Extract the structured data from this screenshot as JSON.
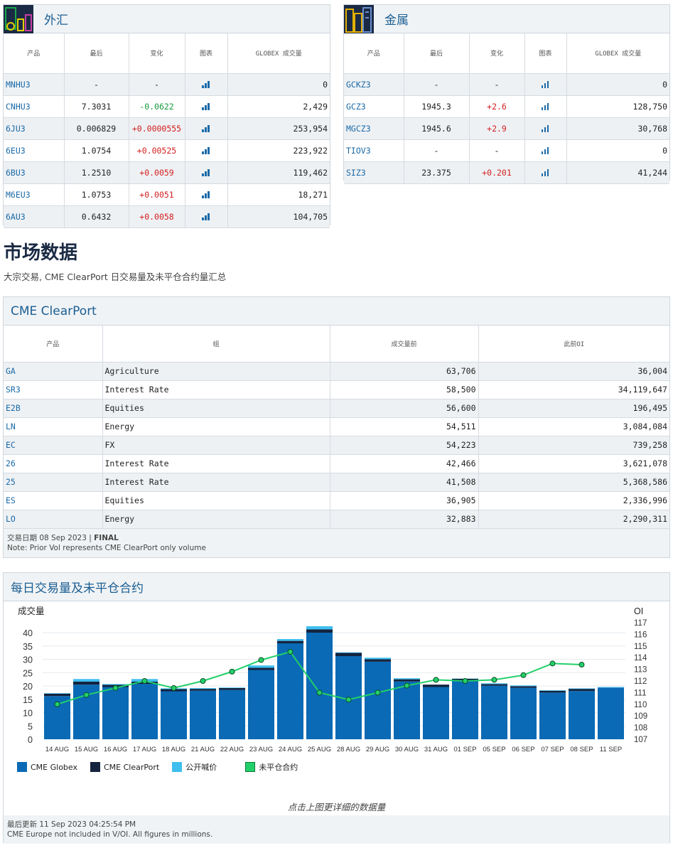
{
  "fx": {
    "title": "外汇",
    "headers": [
      "产品",
      "最后",
      "变化",
      "图表",
      "GLOBEX 成交量"
    ],
    "rows": [
      {
        "sym": "MNHU3",
        "last": "-",
        "chg": "-",
        "dir": "none",
        "vol": "0"
      },
      {
        "sym": "CNHU3",
        "last": "7.3031",
        "chg": "-0.0622",
        "dir": "neg",
        "vol": "2,429"
      },
      {
        "sym": "6JU3",
        "last": "0.006829",
        "chg": "+0.0000555",
        "dir": "pos",
        "vol": "253,954"
      },
      {
        "sym": "6EU3",
        "last": "1.0754",
        "chg": "+0.00525",
        "dir": "pos",
        "vol": "223,922"
      },
      {
        "sym": "6BU3",
        "last": "1.2510",
        "chg": "+0.0059",
        "dir": "pos",
        "vol": "119,462"
      },
      {
        "sym": "M6EU3",
        "last": "1.0753",
        "chg": "+0.0051",
        "dir": "pos",
        "vol": "18,271"
      },
      {
        "sym": "6AU3",
        "last": "0.6432",
        "chg": "+0.0058",
        "dir": "pos",
        "vol": "104,705"
      }
    ]
  },
  "metals": {
    "title": "金属",
    "headers": [
      "产品",
      "最后",
      "变化",
      "图表",
      "GLOBEX 成交量"
    ],
    "rows": [
      {
        "sym": "GCKZ3",
        "last": "-",
        "chg": "-",
        "dir": "none",
        "vol": "0"
      },
      {
        "sym": "GCZ3",
        "last": "1945.3",
        "chg": "+2.6",
        "dir": "pos",
        "vol": "128,750"
      },
      {
        "sym": "MGCZ3",
        "last": "1945.6",
        "chg": "+2.9",
        "dir": "pos",
        "vol": "30,768"
      },
      {
        "sym": "TIOV3",
        "last": "-",
        "chg": "-",
        "dir": "none",
        "vol": "0"
      },
      {
        "sym": "SIZ3",
        "last": "23.375",
        "chg": "+0.201",
        "dir": "pos",
        "vol": "41,244"
      }
    ]
  },
  "market": {
    "title": "市场数据",
    "subtitle": "大宗交易, CME ClearPort 日交易量及未平仓合约量汇总"
  },
  "clearport": {
    "title": "CME ClearPort",
    "headers": [
      "产品",
      "组",
      "成交量前",
      "此前OI"
    ],
    "rows": [
      {
        "sym": "GA",
        "group": "Agriculture",
        "vol": "63,706",
        "oi": "36,004"
      },
      {
        "sym": "SR3",
        "group": "Interest Rate",
        "vol": "58,500",
        "oi": "34,119,647"
      },
      {
        "sym": "E2B",
        "group": "Equities",
        "vol": "56,600",
        "oi": "196,495"
      },
      {
        "sym": "LN",
        "group": "Energy",
        "vol": "54,511",
        "oi": "3,084,084"
      },
      {
        "sym": "EC",
        "group": "FX",
        "vol": "54,223",
        "oi": "739,258"
      },
      {
        "sym": "26",
        "group": "Interest Rate",
        "vol": "42,466",
        "oi": "3,621,078"
      },
      {
        "sym": "25",
        "group": "Interest Rate",
        "vol": "41,508",
        "oi": "5,368,586"
      },
      {
        "sym": "ES",
        "group": "Equities",
        "vol": "36,905",
        "oi": "2,336,996"
      },
      {
        "sym": "LO",
        "group": "Energy",
        "vol": "32,883",
        "oi": "2,290,311"
      }
    ],
    "trade_date": "交易日期 08 Sep 2023 |",
    "final": "FINAL",
    "note": "Note: Prior Vol represents CME ClearPort only volume"
  },
  "daily": {
    "title": "每日交易量及未平仓合约",
    "hint": "点击上图更详细的数据量",
    "updated": "最后更新 11 Sep 2023 04:25:54 PM",
    "note": "CME Europe not included in V/OI. All figures in millions."
  },
  "chart_data": {
    "type": "bar",
    "ylabel": "成交量",
    "y2label": "OI",
    "ylim": [
      0,
      40
    ],
    "yticks": [
      0,
      5,
      10,
      15,
      20,
      25,
      30,
      35,
      40
    ],
    "y2lim": [
      107,
      117
    ],
    "y2ticks": [
      107,
      108,
      109,
      110,
      111,
      112,
      113,
      114,
      115,
      116,
      117
    ],
    "categories": [
      "14 AUG",
      "15 AUG",
      "16 AUG",
      "17 AUG",
      "18 AUG",
      "21 AUG",
      "22 AUG",
      "23 AUG",
      "24 AUG",
      "25 AUG",
      "28 AUG",
      "29 AUG",
      "30 AUG",
      "31 AUG",
      "01 SEP",
      "05 SEP",
      "06 SEP",
      "07 SEP",
      "08 SEP",
      "11 SEP"
    ],
    "series": [
      {
        "name": "CME Globex",
        "kind": "bar",
        "color": "#0a6ab5",
        "values": [
          16.2,
          20.5,
          19.6,
          20.8,
          18.0,
          18.2,
          18.5,
          26.0,
          36.0,
          40.0,
          31.2,
          29.1,
          21.7,
          19.6,
          21.9,
          20.1,
          19.3,
          17.5,
          18.1,
          19.4
        ]
      },
      {
        "name": "CME ClearPort",
        "kind": "bar",
        "color": "#14233e",
        "values": [
          0.9,
          1.1,
          0.8,
          0.8,
          0.8,
          0.7,
          0.7,
          0.8,
          0.9,
          1.2,
          1.2,
          0.9,
          0.8,
          0.9,
          0.8,
          0.6,
          0.6,
          0.7,
          0.8,
          0
        ]
      },
      {
        "name": "公开喊价",
        "kind": "bar",
        "color": "#3fbff0",
        "values": [
          0.2,
          1.0,
          0.3,
          1.0,
          0.3,
          0.3,
          0.2,
          0.9,
          0.7,
          1.2,
          0.2,
          0.6,
          0.4,
          0,
          0.1,
          0.3,
          0.3,
          0.2,
          0.2,
          0.2
        ]
      },
      {
        "name": "未平仓合约",
        "kind": "line",
        "color": "#22d06a",
        "values": [
          110.0,
          110.8,
          111.4,
          112.0,
          111.4,
          112.0,
          112.8,
          113.8,
          114.5,
          111.0,
          110.4,
          111.0,
          111.6,
          112.1,
          112.0,
          112.1,
          112.5,
          113.5,
          113.4,
          null
        ]
      }
    ]
  }
}
